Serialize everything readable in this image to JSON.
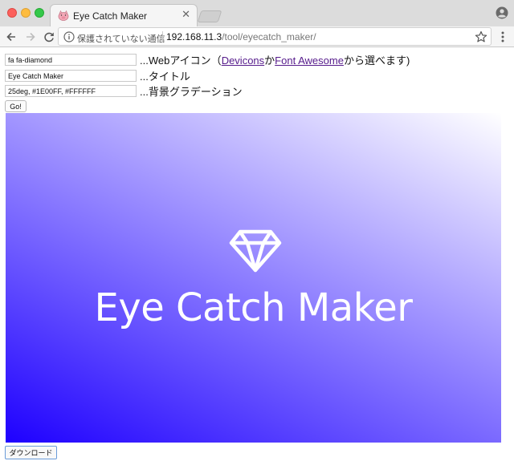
{
  "browser": {
    "tab_title": "Eye Catch Maker",
    "security_label": "保護されていない通信",
    "url_host": "192.168.11.3",
    "url_path": "/tool/eyecatch_maker/"
  },
  "icons": {
    "tab_favicon": "pig-favicon-icon",
    "tab_close": "close-icon",
    "back": "arrow-left-icon",
    "forward": "arrow-right-icon",
    "reload": "reload-icon",
    "info": "info-icon",
    "bookmark": "star-icon",
    "profile": "profile-icon",
    "menu": "vertical-dots-icon",
    "preview_icon": "diamond-icon"
  },
  "form": {
    "icon_field_value": "fa fa-diamond",
    "icon_field_desc_prefix": "...Webアイコン（",
    "link_devicons": "Devicons",
    "icon_field_desc_middle": "か",
    "link_fontawesome": "Font Awesome",
    "icon_field_desc_suffix": "から選べます)",
    "title_field_value": "Eye Catch Maker",
    "title_field_desc": "...タイトル",
    "gradient_field_value": "25deg, #1E00FF, #FFFFFF",
    "gradient_field_desc": "...背景グラデーション",
    "go_button": "Go!"
  },
  "preview": {
    "title": "Eye Catch Maker",
    "gradient_angle": "25deg",
    "gradient_start": "#1E00FF",
    "gradient_end": "#FFFFFF"
  },
  "download_button": "ダウンロード",
  "colors": {
    "link_visited": "#551a8b",
    "download_border": "#6a9cd9"
  }
}
